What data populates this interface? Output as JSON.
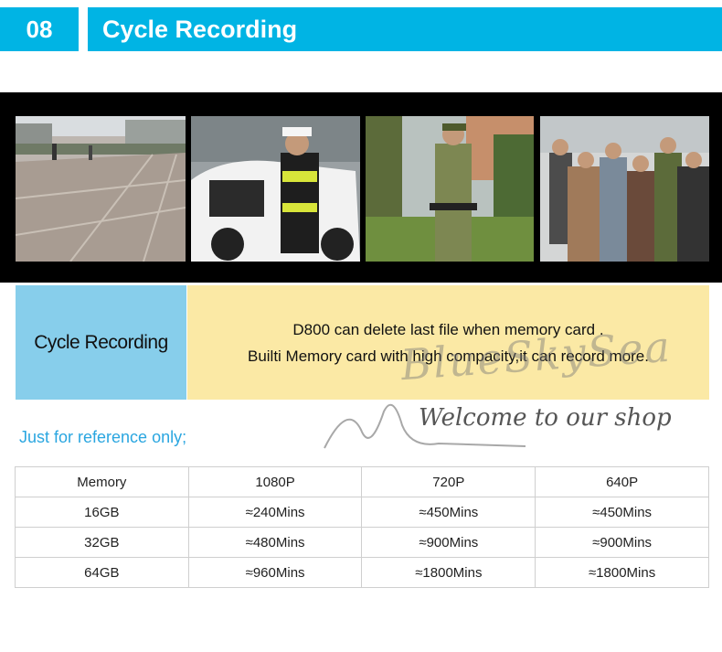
{
  "header": {
    "number": "08",
    "title": "Cycle Recording"
  },
  "info": {
    "label": "Cycle Recording",
    "line1": "D800 can delete last file when memory card .",
    "line2": "Builti Memory card with high compacity,it can record more."
  },
  "watermark": {
    "script": "BlueSkySea",
    "text": "Welcome to our shop"
  },
  "note": "Just for reference only;",
  "table": {
    "header": [
      "Memory",
      "1080P",
      "720P",
      "640P"
    ],
    "rows": [
      [
        "16GB",
        "≈240Mins",
        "≈450Mins",
        "≈450Mins"
      ],
      [
        "32GB",
        "≈480Mins",
        "≈900Mins",
        "≈900Mins"
      ],
      [
        "64GB",
        "≈960Mins",
        "≈1800Mins",
        "≈1800Mins"
      ]
    ]
  }
}
